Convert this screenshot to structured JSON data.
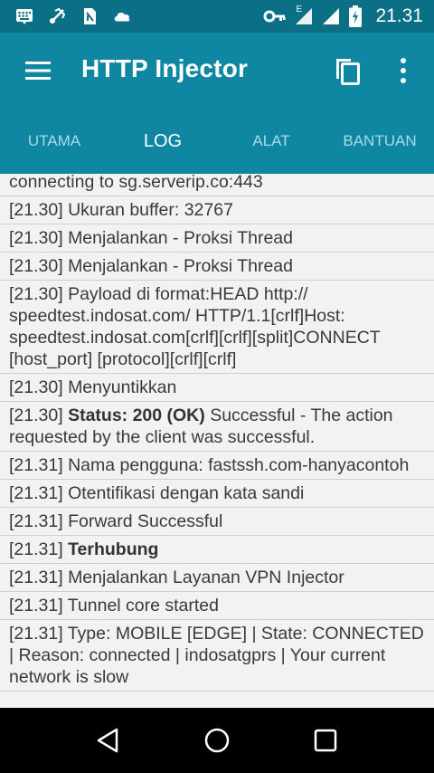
{
  "status_bar": {
    "time": "21.31",
    "icons": [
      "keyboard-icon",
      "bluetooth-share-icon",
      "sim-icon",
      "cloud-icon",
      "vpn-key-icon",
      "signal-e-icon",
      "signal-icon",
      "battery-charging-icon"
    ],
    "network_label": "E"
  },
  "app_bar": {
    "title": "HTTP Injector",
    "background": "#0f87a2"
  },
  "tabs": [
    {
      "label": "UTAMA",
      "active": false
    },
    {
      "label": "LOG",
      "active": true
    },
    {
      "label": "ALAT",
      "active": false
    },
    {
      "label": "BANTUAN",
      "active": false
    }
  ],
  "log": [
    {
      "time": "",
      "plain": "connecting to sg.serverip.co:443",
      "bold": ""
    },
    {
      "time": "[21.30]",
      "plain": "Ukuran buffer: 32767",
      "bold": ""
    },
    {
      "time": "[21.30]",
      "plain": "Menjalankan - Proksi Thread",
      "bold": ""
    },
    {
      "time": "[21.30]",
      "plain": "Menjalankan - Proksi Thread",
      "bold": ""
    },
    {
      "time": "[21.30]",
      "plain": "Payload di format:HEAD http:// speedtest.indosat.com/ HTTP/1.1[crlf]Host: speedtest.indosat.com[crlf][crlf][split]CONNECT [host_port] [protocol][crlf][crlf]",
      "bold": ""
    },
    {
      "time": "[21.30]",
      "plain": "Menyuntikkan",
      "bold": ""
    },
    {
      "time": "[21.30]",
      "bold": "Status: 200 (OK)",
      "plain": "Successful - The action requested by the client was successful."
    },
    {
      "time": "[21.31]",
      "plain": "Nama pengguna: fastssh.com-hanyacontoh",
      "bold": ""
    },
    {
      "time": "[21.31]",
      "plain": "Otentifikasi dengan kata sandi",
      "bold": ""
    },
    {
      "time": "[21.31]",
      "plain": "Forward Successful",
      "bold": ""
    },
    {
      "time": "[21.31]",
      "bold": "Terhubung",
      "plain": ""
    },
    {
      "time": "[21.31]",
      "plain": "Menjalankan Layanan VPN Injector",
      "bold": ""
    },
    {
      "time": "[21.31]",
      "plain": "Tunnel core started",
      "bold": ""
    },
    {
      "time": "[21.31]",
      "plain": "Type: MOBILE [EDGE] | State: CONNECTED | Reason: connected | indosatgprs | Your current network is slow",
      "bold": ""
    }
  ],
  "nav_bar": {
    "buttons": [
      "back-icon",
      "home-icon",
      "recents-icon"
    ]
  }
}
